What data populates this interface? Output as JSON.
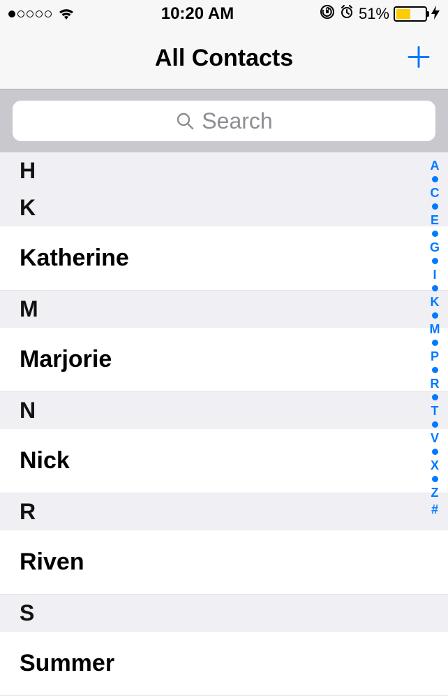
{
  "status": {
    "time": "10:20 AM",
    "battery_pct": "51%",
    "battery_fill_pct": 51
  },
  "nav": {
    "title": "All Contacts"
  },
  "search": {
    "placeholder": "Search"
  },
  "sections": [
    {
      "letter": "H",
      "rows": []
    },
    {
      "letter": "K",
      "rows": [
        "Katherine"
      ]
    },
    {
      "letter": "M",
      "rows": [
        "Marjorie"
      ]
    },
    {
      "letter": "N",
      "rows": [
        "Nick"
      ]
    },
    {
      "letter": "R",
      "rows": [
        "Riven"
      ]
    },
    {
      "letter": "S",
      "rows": [
        "Summer"
      ]
    }
  ],
  "index": [
    "A",
    "•",
    "C",
    "•",
    "E",
    "•",
    "G",
    "•",
    "I",
    "•",
    "K",
    "•",
    "M",
    "•",
    "P",
    "•",
    "R",
    "•",
    "T",
    "•",
    "V",
    "•",
    "X",
    "•",
    "Z",
    "#"
  ]
}
